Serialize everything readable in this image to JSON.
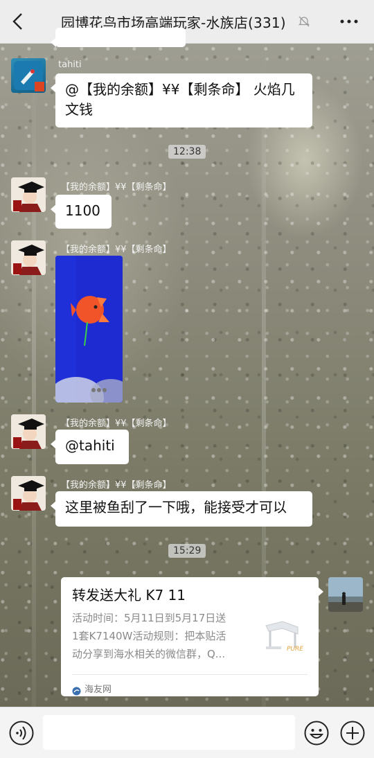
{
  "header": {
    "title": "园博花鸟市场高端玩家-水族店(331)"
  },
  "messages": [
    {
      "type": "text",
      "sender": "tahiti",
      "text_line1": "@【我的余额】¥¥【剩条命】 火焰几",
      "text_line2": "文钱"
    },
    {
      "type": "time",
      "text": "12:38"
    },
    {
      "type": "text",
      "sender": "【我的余额】¥¥【剩条命】",
      "text": "1100"
    },
    {
      "type": "image",
      "sender": "【我的余额】¥¥【剩条命】"
    },
    {
      "type": "text",
      "sender": "【我的余额】¥¥【剩条命】",
      "text": "@tahiti"
    },
    {
      "type": "text",
      "sender": "【我的余额】¥¥【剩条命】",
      "text": "这里被鱼刮了一下哦，能接受才可以"
    },
    {
      "type": "time",
      "text": "15:29"
    },
    {
      "type": "link-card",
      "title": "转发送大礼 K7 11",
      "desc_line1": "活动时间：5月11日到5月17日送",
      "desc_line2": "1套K7140W活动规则：把本贴活",
      "desc_line3": "动分享到海水相关的微信群，Q...",
      "source": "海友网",
      "thumb_label": "PURE"
    }
  ],
  "colors": {
    "bubble": "#ffffff",
    "topbar": "#ededed",
    "bottombar": "#f4f4f4"
  },
  "icons": [
    "back-icon",
    "mute-bell-icon",
    "more-icon",
    "voice-icon",
    "emoji-icon",
    "plus-icon"
  ]
}
